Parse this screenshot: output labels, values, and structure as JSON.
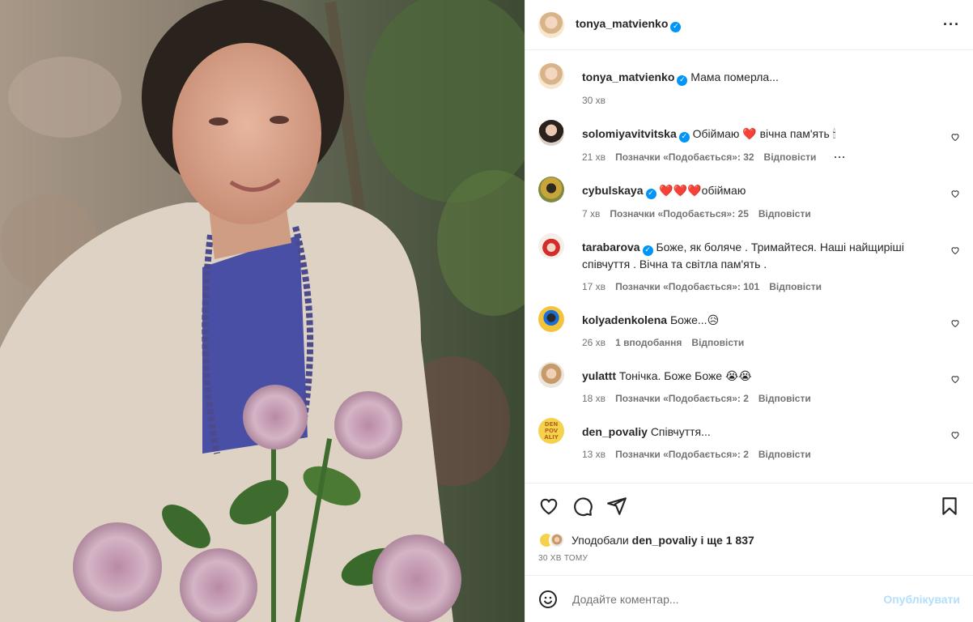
{
  "post": {
    "author": "tonya_matvienko",
    "caption_text": "Мама померла...",
    "caption_time": "30 хв",
    "more_icon": "more-horizontal-icon"
  },
  "comments": [
    {
      "user": "solomiyavitvitska",
      "verified": true,
      "text": "Обіймаю ❤️ вічна пам'ять 🕯",
      "time": "21 хв",
      "likes": "Позначки «Подобається»: 32",
      "reply": "Відповісти",
      "more": "···"
    },
    {
      "user": "cybulskaya",
      "verified": true,
      "text": "❤️❤️❤️обіймаю",
      "time": "7 хв",
      "likes": "Позначки «Подобається»: 25",
      "reply": "Відповісти"
    },
    {
      "user": "tarabarova",
      "verified": true,
      "text": "Боже, як боляче . Тримайтеся. Наші найщиріші співчуття . Вічна та світла пам'ять .",
      "time": "17 хв",
      "likes": "Позначки «Подобається»: 101",
      "reply": "Відповісти"
    },
    {
      "user": "kolyadenkolena",
      "verified": false,
      "text": "Боже...😥",
      "time": "26 хв",
      "likes": "1 вподобання",
      "reply": "Відповісти"
    },
    {
      "user": "yulattt",
      "verified": false,
      "text": "Тонічка. Боже Боже 😭😭",
      "time": "18 хв",
      "likes": "Позначки «Подобається»: 2",
      "reply": "Відповісти"
    },
    {
      "user": "den_povaliy",
      "verified": false,
      "text": "Співчуття...",
      "time": "13 хв",
      "likes": "Позначки «Подобається»: 2",
      "reply": "Відповісти"
    }
  ],
  "den_avatar_text": "DEN\nPOV\nALIY",
  "likes_line": {
    "prefix": "Уподобали",
    "user": "den_povaliy",
    "suffix": "і ще 1 837"
  },
  "post_time": "30 ХВ ТОМУ",
  "add_comment": {
    "placeholder": "Додайте коментар...",
    "post_label": "Опублікувати"
  },
  "colors": {
    "verified": "#0095f6",
    "muted": "#737373",
    "post_disabled": "#b2dffc"
  }
}
